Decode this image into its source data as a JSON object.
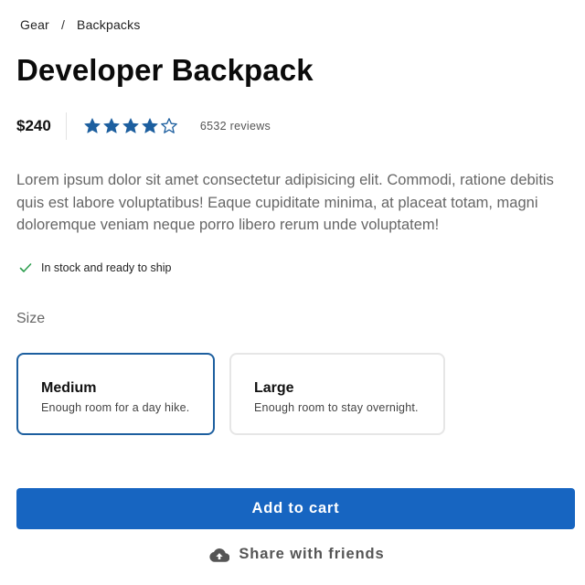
{
  "breadcrumb": {
    "items": [
      "Gear",
      "Backpacks"
    ],
    "separator": "/"
  },
  "product": {
    "title": "Developer Backpack",
    "price": "$240",
    "rating": {
      "value": 4,
      "max": 5
    },
    "reviews": "6532 reviews",
    "description": "Lorem ipsum dolor sit amet consectetur adipisicing elit. Commodi, ratione debitis quis est labore voluptatibus! Eaque cupiditate minima, at placeat totam, magni doloremque veniam neque porro libero rerum unde voluptatem!",
    "stock": "In stock and ready to ship"
  },
  "size": {
    "label": "Size",
    "options": [
      {
        "name": "Medium",
        "description": "Enough room for a day hike.",
        "selected": true
      },
      {
        "name": "Large",
        "description": "Enough room to stay overnight.",
        "selected": false
      }
    ]
  },
  "actions": {
    "add_to_cart": "Add to cart",
    "share": "Share with friends"
  },
  "colors": {
    "accent": "#1765c1",
    "star": "#1d5f9f",
    "selected_border": "#1d5f9f",
    "check": "#2e9e4f"
  },
  "icons": {
    "star_filled": "star-filled-icon",
    "star_empty": "star-outline-icon",
    "check": "check-icon",
    "share": "cloud-upload-icon"
  }
}
